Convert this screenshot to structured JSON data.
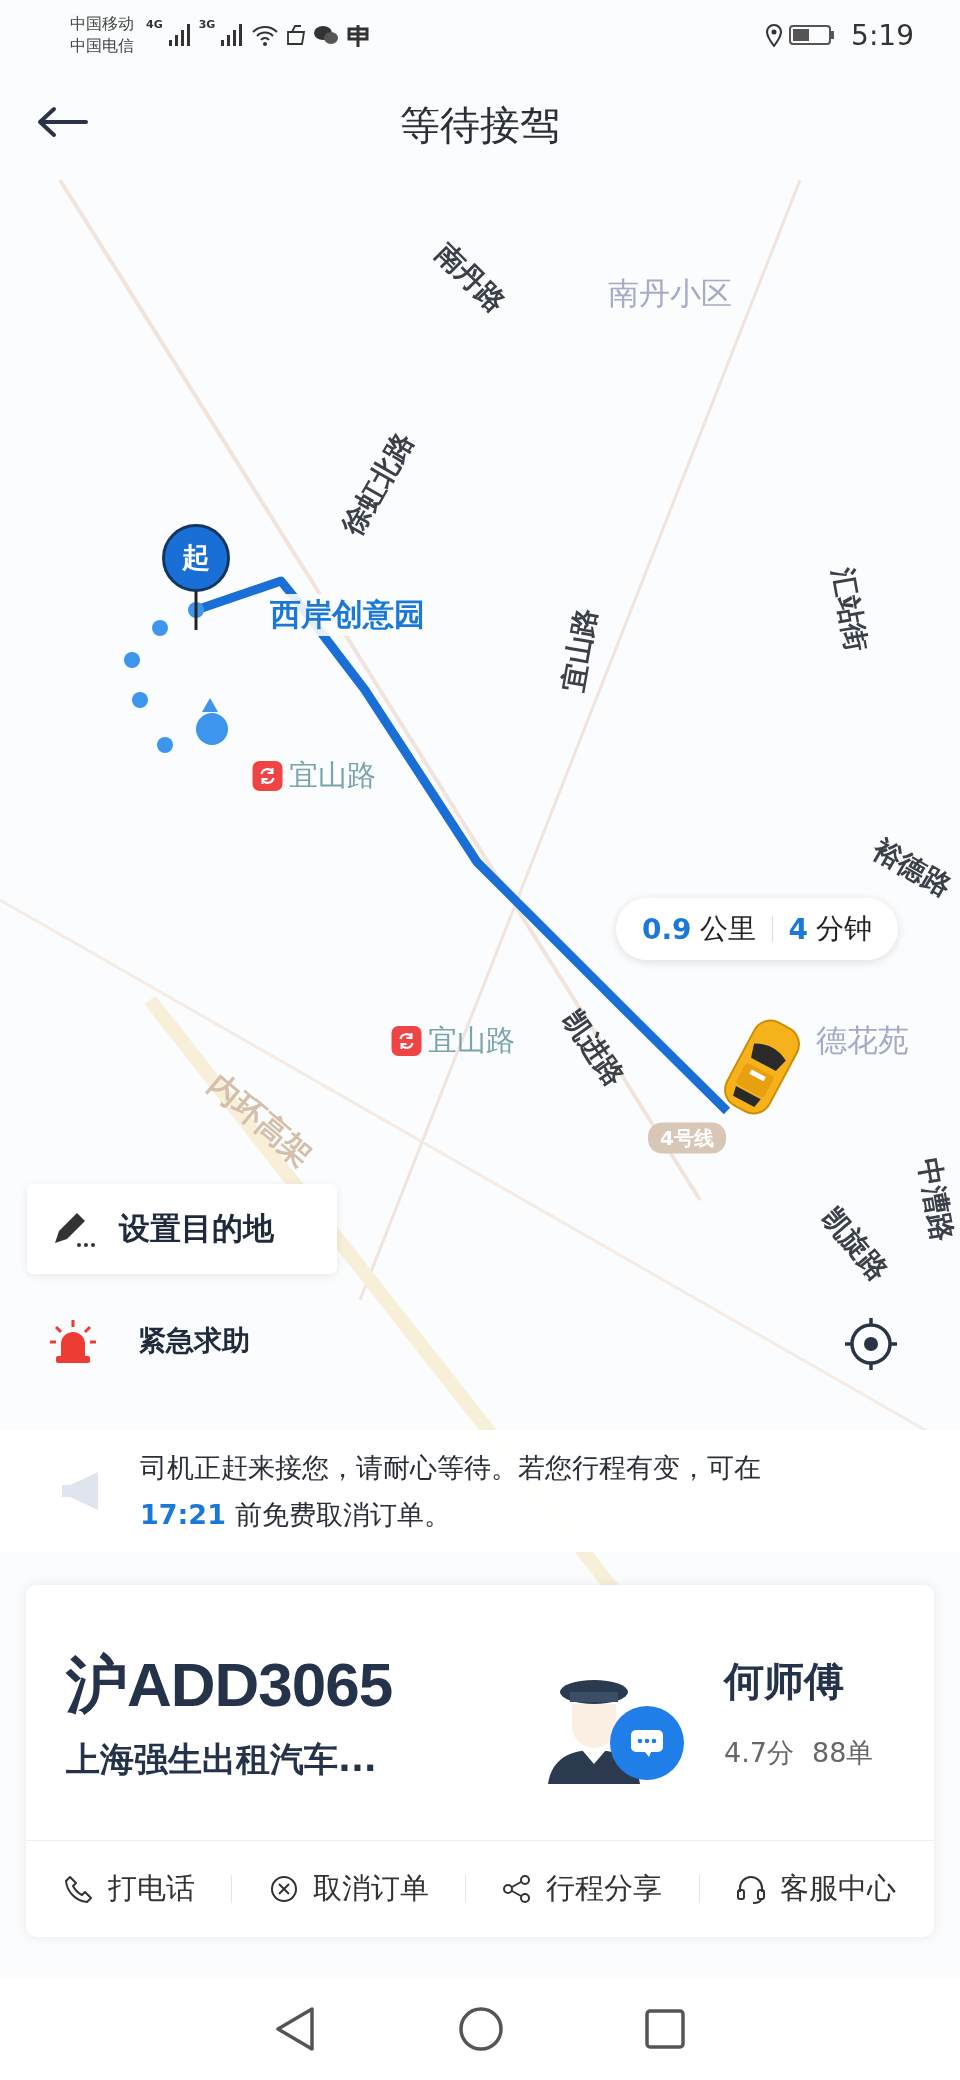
{
  "status_bar": {
    "carriers": [
      "中国移动",
      "中国电信"
    ],
    "network_badges": [
      "4G",
      "3G"
    ],
    "time": "5:19"
  },
  "header": {
    "title": "等待接驾"
  },
  "map": {
    "labels": [
      {
        "text": "南丹路",
        "kind": "road"
      },
      {
        "text": "南丹小区",
        "kind": "area"
      },
      {
        "text": "徐虹北路",
        "kind": "road"
      },
      {
        "text": "宜山路",
        "kind": "road"
      },
      {
        "text": "汇站街",
        "kind": "road"
      },
      {
        "text": "裕德路",
        "kind": "road"
      },
      {
        "text": "凯进路",
        "kind": "road"
      },
      {
        "text": "德花苑",
        "kind": "area"
      },
      {
        "text": "内环高架",
        "kind": "highway"
      },
      {
        "text": "4号线",
        "kind": "line"
      },
      {
        "text": "中漕路",
        "kind": "road"
      },
      {
        "text": "凯旋路",
        "kind": "road"
      },
      {
        "text": "宜山路",
        "kind": "metro"
      },
      {
        "text": "宜山路",
        "kind": "metro"
      },
      {
        "text": "西岸创意园",
        "kind": "poi"
      }
    ],
    "start_pin": "起",
    "eta": {
      "distance": "0.9",
      "distance_unit": "公里",
      "minutes": "4",
      "minutes_unit": "分钟"
    }
  },
  "set_destination": "设置目的地",
  "emergency": "紧急求助",
  "notice": {
    "before": "司机正赶来接您，请耐心等待。若您行程有变，可在",
    "time": "17:21",
    "after": " 前免费取消订单。"
  },
  "driver": {
    "plate": "沪ADD3065",
    "company": "上海强生出租汽车...",
    "name": "何师傅",
    "rating": "4.7分",
    "orders": "88单"
  },
  "actions": [
    {
      "label": "打电话",
      "kind": "phone"
    },
    {
      "label": "取消订单",
      "kind": "cancel"
    },
    {
      "label": "行程分享",
      "kind": "share"
    },
    {
      "label": "客服中心",
      "kind": "service"
    }
  ]
}
